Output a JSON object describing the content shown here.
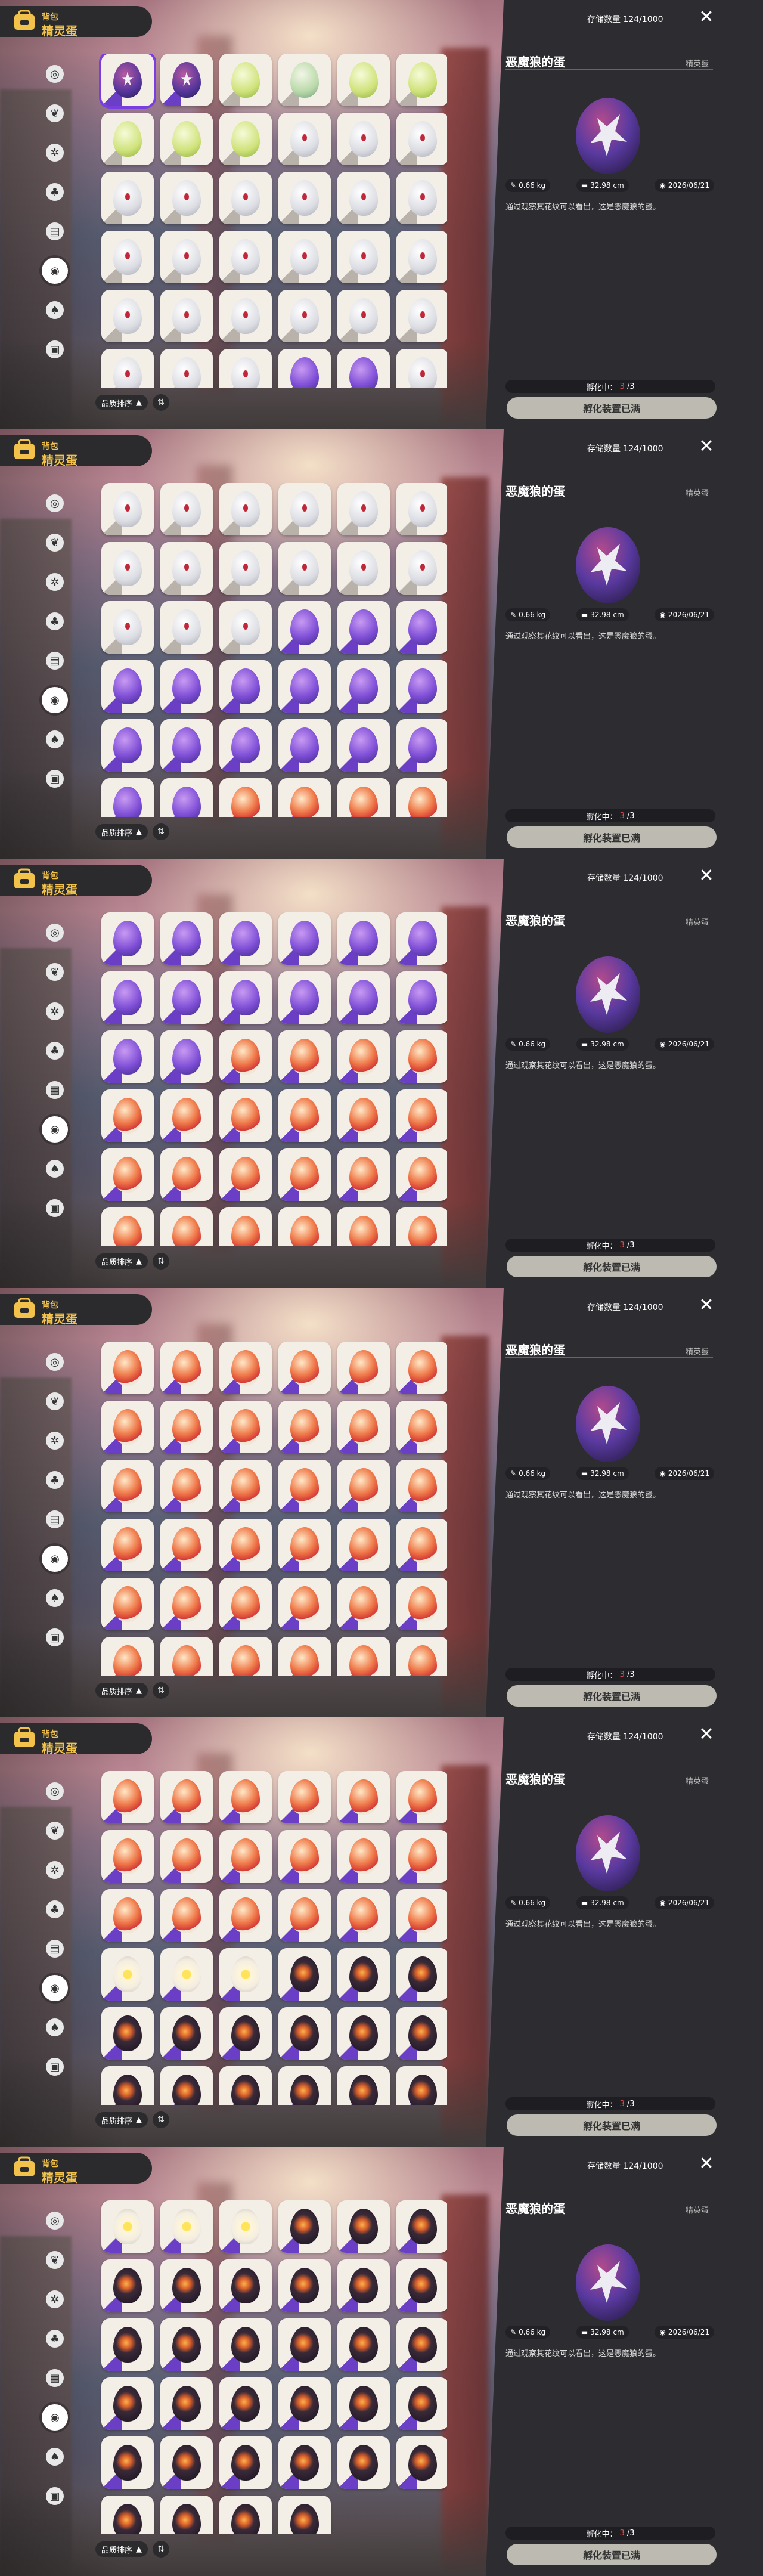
{
  "header": {
    "bag_label": "背包",
    "title": "精灵蛋"
  },
  "sidebar": {
    "items": [
      {
        "name": "category-ball",
        "glyph": "◎"
      },
      {
        "name": "category-leaf",
        "glyph": "❦"
      },
      {
        "name": "category-gear",
        "glyph": "✲"
      },
      {
        "name": "category-plant",
        "glyph": "♣"
      },
      {
        "name": "category-book",
        "glyph": "▤"
      },
      {
        "name": "category-egg",
        "glyph": "◉"
      },
      {
        "name": "category-acorn",
        "glyph": "♠"
      },
      {
        "name": "category-chest",
        "glyph": "▣"
      }
    ],
    "active_index": 5
  },
  "sort": {
    "label": "品质排序",
    "order_glyph": "▲",
    "toggle_glyph": "⇅"
  },
  "detail": {
    "stock_label": "存储数量",
    "stock_value": "124/1000",
    "close_glyph": "✕",
    "title": "恶魔狼的蛋",
    "rarity": "精英蛋",
    "weight": "0.66 kg",
    "size": "32.98 cm",
    "date": "2026/06/21",
    "description": "通过观察其花纹可以看出，这是恶魔狼的蛋。",
    "incubate_label": "孵化中：",
    "incubate_current": "3",
    "incubate_total": "/3",
    "hatch_button": "孵化装置已满"
  },
  "colors": {
    "accent_red": "#d84d49",
    "selection": "#7a3ee0",
    "panel": "#2d2d31",
    "gold": "#f2c24a"
  },
  "frames": [
    {
      "rows": [
        [
          "violet-star",
          "violet-star",
          "green",
          "green-spot",
          "green",
          "green"
        ],
        [
          "green",
          "green",
          "green",
          "white-red",
          "white-red",
          "white-red"
        ],
        [
          "white-red",
          "white-red",
          "white-red",
          "white-red",
          "white-red",
          "white-red"
        ],
        [
          "white-red",
          "white-red",
          "white-red",
          "white-red",
          "white-red",
          "white-red"
        ],
        [
          "white-red",
          "white-red",
          "white-red",
          "white-red",
          "white-red",
          "white-red"
        ],
        [
          "white-red",
          "white-red",
          "white-red",
          "violet",
          "violet",
          "white-red"
        ]
      ]
    },
    {
      "rows": [
        [
          "white-red",
          "white-red",
          "white-red",
          "white-red",
          "white-red",
          "white-red"
        ],
        [
          "white-red",
          "white-red",
          "white-red",
          "white-red",
          "white-red",
          "white-red"
        ],
        [
          "white-red",
          "white-red",
          "white-red",
          "violet",
          "violet",
          "violet"
        ],
        [
          "violet",
          "violet",
          "violet",
          "violet",
          "violet",
          "violet"
        ],
        [
          "violet",
          "violet",
          "violet",
          "violet",
          "violet",
          "violet"
        ],
        [
          "violet",
          "violet",
          "fire",
          "fire",
          "fire",
          "fire"
        ]
      ]
    },
    {
      "rows": [
        [
          "violet",
          "violet",
          "violet",
          "violet",
          "violet",
          "violet"
        ],
        [
          "violet",
          "violet",
          "violet",
          "violet",
          "violet",
          "violet"
        ],
        [
          "violet",
          "violet",
          "fire",
          "fire",
          "fire",
          "fire"
        ],
        [
          "fire",
          "fire",
          "fire",
          "fire",
          "fire",
          "fire"
        ],
        [
          "fire",
          "fire",
          "fire",
          "fire",
          "fire",
          "fire"
        ],
        [
          "fire",
          "fire",
          "fire",
          "fire",
          "fire",
          "fire"
        ]
      ]
    },
    {
      "rows": [
        [
          "fire",
          "fire",
          "fire",
          "fire",
          "fire",
          "fire"
        ],
        [
          "fire",
          "fire",
          "fire",
          "fire",
          "fire",
          "fire"
        ],
        [
          "fire",
          "fire",
          "fire",
          "fire",
          "fire",
          "fire"
        ],
        [
          "fire",
          "fire",
          "fire",
          "fire",
          "fire",
          "fire"
        ],
        [
          "fire",
          "fire",
          "fire",
          "fire",
          "fire",
          "fire"
        ],
        [
          "fire",
          "fire",
          "fire",
          "fire",
          "fire",
          "fire"
        ]
      ]
    },
    {
      "rows": [
        [
          "fire",
          "fire",
          "fire",
          "fire",
          "fire",
          "fire"
        ],
        [
          "fire",
          "fire",
          "fire",
          "fire",
          "fire",
          "fire"
        ],
        [
          "fire",
          "fire",
          "fire",
          "fire",
          "fire",
          "fire"
        ],
        [
          "yolk",
          "yolk",
          "yolk",
          "dark",
          "dark",
          "dark"
        ],
        [
          "dark",
          "dark",
          "dark",
          "dark",
          "dark",
          "dark"
        ],
        [
          "dark",
          "dark",
          "dark",
          "dark",
          "dark",
          "dark"
        ]
      ]
    },
    {
      "rows": [
        [
          "yolk",
          "yolk",
          "yolk",
          "dark",
          "dark",
          "dark"
        ],
        [
          "dark",
          "dark",
          "dark",
          "dark",
          "dark",
          "dark"
        ],
        [
          "dark",
          "dark",
          "dark",
          "dark",
          "dark",
          "dark"
        ],
        [
          "dark",
          "dark",
          "dark",
          "dark",
          "dark",
          "dark"
        ],
        [
          "dark",
          "dark",
          "dark",
          "dark",
          "dark",
          "dark"
        ],
        [
          "dark",
          "dark",
          "dark",
          "dark"
        ]
      ]
    }
  ]
}
